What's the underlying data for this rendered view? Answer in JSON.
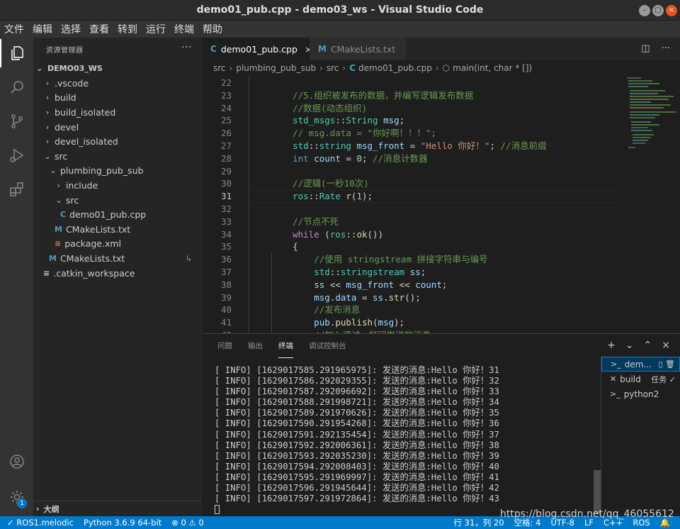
{
  "window": {
    "title": "demo01_pub.cpp - demo03_ws - Visual Studio Code"
  },
  "menu": [
    "文件",
    "编辑",
    "选择",
    "查看",
    "转到",
    "运行",
    "终端",
    "帮助"
  ],
  "activity": {
    "account_badge": "1"
  },
  "sidebar": {
    "header": "资源管理器",
    "more": "···",
    "root": "DEMO03_WS",
    "items": [
      {
        "label": ".vscode",
        "chev": "›"
      },
      {
        "label": "build",
        "chev": "›"
      },
      {
        "label": "build_isolated",
        "chev": "›"
      },
      {
        "label": "devel",
        "chev": "›"
      },
      {
        "label": "devel_isolated",
        "chev": "›"
      },
      {
        "label": "src",
        "chev": "⌄"
      },
      {
        "label": "plumbing_pub_sub",
        "chev": "⌄"
      },
      {
        "label": "include",
        "chev": "›"
      },
      {
        "label": "src",
        "chev": "⌄"
      },
      {
        "label": "demo01_pub.cpp",
        "icon": "C"
      },
      {
        "label": "CMakeLists.txt",
        "icon": "M"
      },
      {
        "label": "package.xml",
        "icon": "≡"
      },
      {
        "label": "CMakeLists.txt",
        "icon": "M"
      },
      {
        "label": ".catkin_workspace",
        "icon": "≡"
      }
    ],
    "footer": "大纲"
  },
  "tabs": [
    {
      "label": "demo01_pub.cpp",
      "icon": "C"
    },
    {
      "label": "CMakeLists.txt",
      "icon": "M"
    }
  ],
  "breadcrumb": [
    "src",
    "plumbing_pub_sub",
    "src",
    "demo01_pub.cpp",
    "main(int, char * [])"
  ],
  "editor": {
    "current_line": 31,
    "lines": [
      {
        "n": "22",
        "segs": []
      },
      {
        "n": "23",
        "segs": [
          {
            "t": "    ",
            "c": ""
          },
          {
            "t": "//5.组织被发布的数据，并编写逻辑发布数据",
            "c": "c-com"
          }
        ]
      },
      {
        "n": "24",
        "segs": [
          {
            "t": "    ",
            "c": ""
          },
          {
            "t": "//数据(动态组织)",
            "c": "c-com"
          }
        ]
      },
      {
        "n": "25",
        "segs": [
          {
            "t": "    ",
            "c": ""
          },
          {
            "t": "std_msgs",
            "c": "c-typ"
          },
          {
            "t": "::",
            "c": ""
          },
          {
            "t": "String",
            "c": "c-typ"
          },
          {
            "t": " ",
            "c": ""
          },
          {
            "t": "msg",
            "c": "c-var"
          },
          {
            "t": ";",
            "c": ""
          }
        ]
      },
      {
        "n": "26",
        "segs": [
          {
            "t": "    ",
            "c": ""
          },
          {
            "t": "// msg.data = \"你好啊！！！\";",
            "c": "c-com"
          }
        ]
      },
      {
        "n": "27",
        "segs": [
          {
            "t": "    ",
            "c": ""
          },
          {
            "t": "std",
            "c": "c-typ"
          },
          {
            "t": "::",
            "c": ""
          },
          {
            "t": "string",
            "c": "c-typ"
          },
          {
            "t": " ",
            "c": ""
          },
          {
            "t": "msg_front",
            "c": "c-var"
          },
          {
            "t": " = ",
            "c": ""
          },
          {
            "t": "\"Hello 你好！\"",
            "c": "c-str"
          },
          {
            "t": "; ",
            "c": ""
          },
          {
            "t": "//消息前缀",
            "c": "c-com"
          }
        ]
      },
      {
        "n": "28",
        "segs": [
          {
            "t": "    ",
            "c": ""
          },
          {
            "t": "int",
            "c": "c-kw"
          },
          {
            "t": " ",
            "c": ""
          },
          {
            "t": "count",
            "c": "c-var"
          },
          {
            "t": " = ",
            "c": ""
          },
          {
            "t": "0",
            "c": "c-num"
          },
          {
            "t": "; ",
            "c": ""
          },
          {
            "t": "//消息计数器",
            "c": "c-com"
          }
        ]
      },
      {
        "n": "29",
        "segs": []
      },
      {
        "n": "30",
        "segs": [
          {
            "t": "    ",
            "c": ""
          },
          {
            "t": "//逻辑(一秒10次)",
            "c": "c-com"
          }
        ]
      },
      {
        "n": "31",
        "segs": [
          {
            "t": "    ",
            "c": ""
          },
          {
            "t": "ros",
            "c": "c-typ"
          },
          {
            "t": "::",
            "c": ""
          },
          {
            "t": "Rate",
            "c": "c-typ"
          },
          {
            "t": " ",
            "c": ""
          },
          {
            "t": "r",
            "c": "c-fn"
          },
          {
            "t": "(",
            "c": ""
          },
          {
            "t": "1",
            "c": "c-num"
          },
          {
            "t": ");",
            "c": ""
          }
        ]
      },
      {
        "n": "32",
        "segs": []
      },
      {
        "n": "33",
        "segs": [
          {
            "t": "    ",
            "c": ""
          },
          {
            "t": "//节点不死",
            "c": "c-com"
          }
        ]
      },
      {
        "n": "34",
        "segs": [
          {
            "t": "    ",
            "c": ""
          },
          {
            "t": "while",
            "c": "c-ctl"
          },
          {
            "t": " (",
            "c": ""
          },
          {
            "t": "ros",
            "c": "c-typ"
          },
          {
            "t": "::",
            "c": ""
          },
          {
            "t": "ok",
            "c": "c-fn"
          },
          {
            "t": "())",
            "c": ""
          }
        ]
      },
      {
        "n": "35",
        "segs": [
          {
            "t": "    {",
            "c": ""
          }
        ]
      },
      {
        "n": "36",
        "segs": [
          {
            "t": "        ",
            "c": ""
          },
          {
            "t": "//使用 stringstream 拼接字符串与编号",
            "c": "c-com"
          }
        ]
      },
      {
        "n": "37",
        "segs": [
          {
            "t": "        ",
            "c": ""
          },
          {
            "t": "std",
            "c": "c-typ"
          },
          {
            "t": "::",
            "c": ""
          },
          {
            "t": "stringstream",
            "c": "c-typ"
          },
          {
            "t": " ",
            "c": ""
          },
          {
            "t": "ss",
            "c": "c-var"
          },
          {
            "t": ";",
            "c": ""
          }
        ]
      },
      {
        "n": "38",
        "segs": [
          {
            "t": "        ",
            "c": ""
          },
          {
            "t": "ss",
            "c": "c-var"
          },
          {
            "t": " << ",
            "c": ""
          },
          {
            "t": "msg_front",
            "c": "c-var"
          },
          {
            "t": " << ",
            "c": ""
          },
          {
            "t": "count",
            "c": "c-var"
          },
          {
            "t": ";",
            "c": ""
          }
        ]
      },
      {
        "n": "39",
        "segs": [
          {
            "t": "        ",
            "c": ""
          },
          {
            "t": "msg",
            "c": "c-var"
          },
          {
            "t": ".",
            "c": ""
          },
          {
            "t": "data",
            "c": "c-var"
          },
          {
            "t": " = ",
            "c": ""
          },
          {
            "t": "ss",
            "c": "c-var"
          },
          {
            "t": ".",
            "c": ""
          },
          {
            "t": "str",
            "c": "c-fn"
          },
          {
            "t": "();",
            "c": ""
          }
        ]
      },
      {
        "n": "40",
        "segs": [
          {
            "t": "        ",
            "c": ""
          },
          {
            "t": "//发布消息",
            "c": "c-com"
          }
        ]
      },
      {
        "n": "41",
        "segs": [
          {
            "t": "        ",
            "c": ""
          },
          {
            "t": "pub",
            "c": "c-var"
          },
          {
            "t": ".",
            "c": ""
          },
          {
            "t": "publish",
            "c": "c-fn"
          },
          {
            "t": "(",
            "c": ""
          },
          {
            "t": "msg",
            "c": "c-var"
          },
          {
            "t": ");",
            "c": ""
          }
        ]
      },
      {
        "n": "42",
        "segs": [
          {
            "t": "        ",
            "c": ""
          },
          {
            "t": "//加入调试，打印发送的消息",
            "c": "c-com"
          }
        ]
      }
    ]
  },
  "panel": {
    "tabs": [
      "问题",
      "输出",
      "终端",
      "调试控制台"
    ],
    "active_tab": 2,
    "actions": [
      "+",
      "⌄",
      "⌃",
      "×"
    ],
    "terminal_lines": [
      "[ INFO] [1629017585.291965975]: 发送的消息:Hello 你好！31",
      "[ INFO] [1629017586.292029355]: 发送的消息:Hello 你好！32",
      "[ INFO] [1629017587.292096692]: 发送的消息:Hello 你好！33",
      "[ INFO] [1629017588.291998721]: 发送的消息:Hello 你好！34",
      "[ INFO] [1629017589.291970626]: 发送的消息:Hello 你好！35",
      "[ INFO] [1629017590.291954268]: 发送的消息:Hello 你好！36",
      "[ INFO] [1629017591.292135454]: 发送的消息:Hello 你好！37",
      "[ INFO] [1629017592.292006361]: 发送的消息:Hello 你好！38",
      "[ INFO] [1629017593.292035230]: 发送的消息:Hello 你好！39",
      "[ INFO] [1629017594.292008403]: 发送的消息:Hello 你好！40",
      "[ INFO] [1629017595.291969997]: 发送的消息:Hello 你好！41",
      "[ INFO] [1629017596.291945644]: 发送的消息:Hello 你好！42",
      "[ INFO] [1629017597.291972864]: 发送的消息:Hello 你好！43"
    ],
    "terminals": [
      {
        "label": "dem...",
        "icon": ">_",
        "extra": "▯ 🗑"
      },
      {
        "label": "build",
        "icon": "✕",
        "extra": "任务 ✓"
      },
      {
        "label": "python2",
        "icon": ">_",
        "extra": ""
      }
    ]
  },
  "statusbar": {
    "left": [
      "✓ ROS1.melodic",
      "Python 3.6.9 64-bit",
      "⊗ 0 ⚠ 0"
    ],
    "right": [
      "行 31，列 20",
      "空格: 4",
      "UTF-8",
      "LF",
      "C++",
      "ROS"
    ]
  },
  "watermark": "https://blog.csdn.net/qq_46055612",
  "colors": {
    "accent": "#007acc",
    "editor_bg": "#1e1e1e",
    "sidebar_bg": "#252526"
  }
}
